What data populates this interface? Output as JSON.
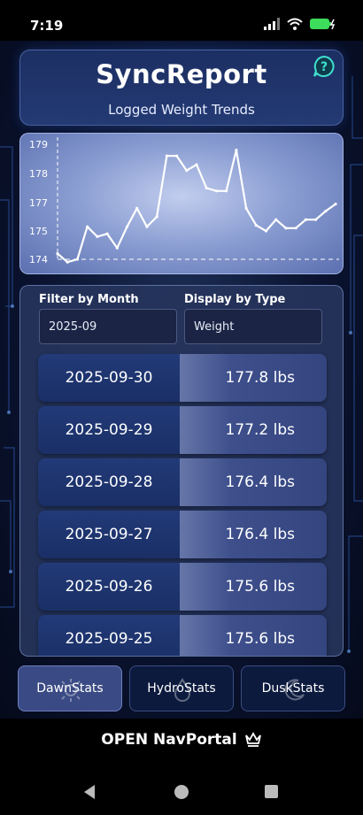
{
  "status_bar": {
    "time": "7:19"
  },
  "header": {
    "title": "SyncReport",
    "subtitle": "Logged Weight Trends"
  },
  "chart_data": {
    "type": "line",
    "title": "",
    "xlabel": "",
    "ylabel": "",
    "y_ticks": [
      "174",
      "175",
      "177",
      "178",
      "179"
    ],
    "series": [
      {
        "values": [
          174.2,
          173.9,
          174.0,
          175.3,
          174.8,
          174.9,
          174.4,
          175.3,
          176.6,
          175.3,
          176.0,
          178.6,
          178.6,
          178.1,
          178.3,
          177.5,
          177.4,
          177.4,
          178.8,
          176.6,
          175.4,
          175.0,
          175.8,
          175.2,
          175.2,
          175.8,
          175.8,
          176.4,
          176.9
        ]
      }
    ],
    "reference_lines": [
      174,
      179
    ],
    "line_color": "#ffffff"
  },
  "filters": {
    "month_label": "Filter by Month",
    "month_value": "2025-09",
    "type_label": "Display by Type",
    "type_value": "Weight"
  },
  "entries": [
    {
      "date": "2025-09-30",
      "value": "177.8 lbs"
    },
    {
      "date": "2025-09-29",
      "value": "177.2 lbs"
    },
    {
      "date": "2025-09-28",
      "value": "176.4 lbs"
    },
    {
      "date": "2025-09-27",
      "value": "176.4 lbs"
    },
    {
      "date": "2025-09-26",
      "value": "175.6 lbs"
    },
    {
      "date": "2025-09-25",
      "value": "175.6 lbs"
    }
  ],
  "tabs": [
    {
      "label": "DawnStats",
      "icon": "sun-icon",
      "active": true
    },
    {
      "label": "HydroStats",
      "icon": "water-drop-icon",
      "active": false
    },
    {
      "label": "DuskStats",
      "icon": "moon-icon",
      "active": false
    }
  ],
  "nav": {
    "label": "OPEN NavPortal",
    "icon": "crown-icon"
  }
}
